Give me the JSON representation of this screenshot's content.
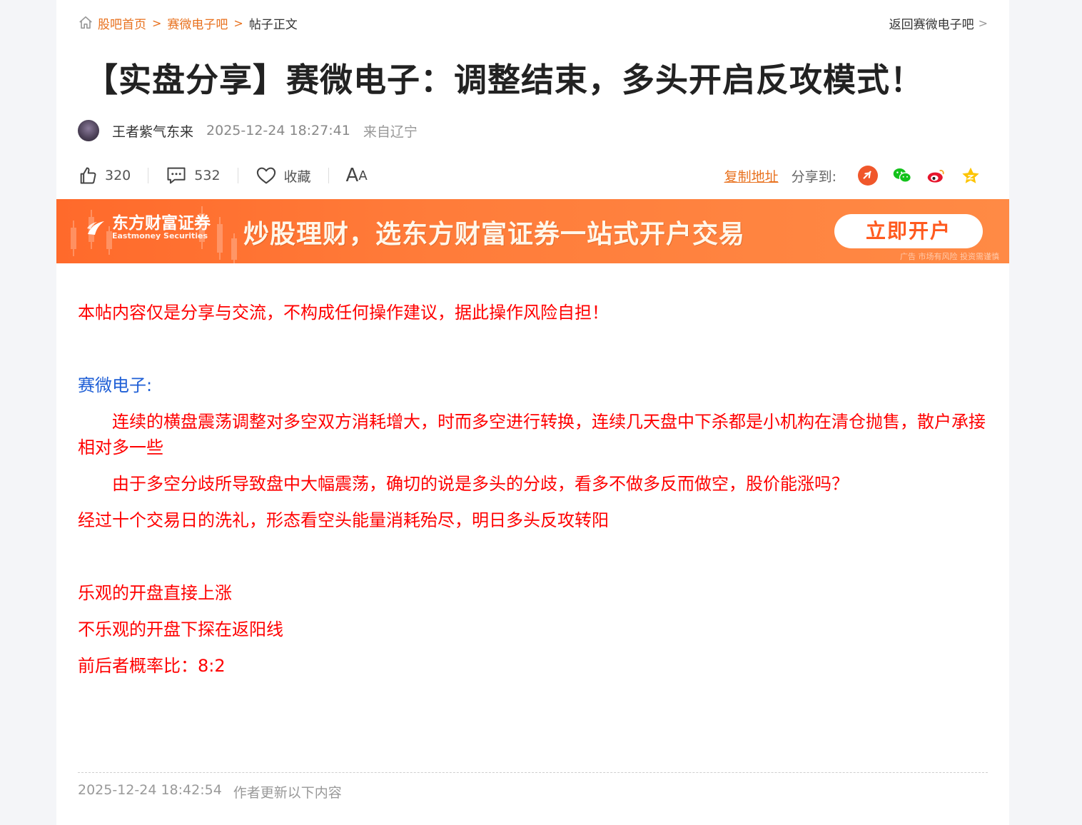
{
  "breadcrumb": {
    "home": "股吧首页",
    "bar": "赛微电子吧",
    "current": "帖子正文",
    "back": "返回赛微电子吧"
  },
  "post": {
    "title": "【实盘分享】赛微电子：调整结束，多头开启反攻模式！",
    "author": "王者紫气东来",
    "time": "2025-12-24 18:27:41",
    "location": "来自辽宁"
  },
  "actions": {
    "likes": "320",
    "comments": "532",
    "favorite": "收藏",
    "font_large": "A",
    "font_small": "A",
    "copy_link": "复制地址",
    "share_label": "分享到:"
  },
  "share_icons": [
    "toutiao-icon",
    "wechat-icon",
    "weibo-icon",
    "qzone-icon"
  ],
  "banner": {
    "logo_cn": "东方财富证券",
    "logo_en": "Eastmoney Securities",
    "slogan": "炒股理财，选东方财富证券一站式开户交易",
    "cta": "立即开户",
    "ad_note": "广告 市场有风险 投资需谨慎"
  },
  "content": {
    "disclaimer": "本帖内容仅是分享与交流，不构成任何操作建议，据此操作风险自担！",
    "stock_heading": "赛微电子:",
    "para1": "连续的横盘震荡调整对多空双方消耗增大，时而多空进行转换，连续几天盘中下杀都是小机构在清仓抛售，散户承接相对多一些",
    "para2": "由于多空分歧所导致盘中大幅震荡，确切的说是多头的分歧，看多不做多反而做空，股价能涨吗？",
    "para3": "经过十个交易日的洗礼，形态看空头能量消耗殆尽，明日多头反攻转阳",
    "scenario1": "乐观的开盘直接上涨",
    "scenario2": "不乐观的开盘下探在返阳线",
    "ratio": "前后者概率比：8:2"
  },
  "update": {
    "time": "2025-12-24 18:42:54",
    "label": "作者更新以下内容"
  },
  "colors": {
    "accent": "#e8711e",
    "content_red": "#ff0000",
    "content_blue": "#1f5fd6",
    "banner": "#ff6a2b"
  }
}
